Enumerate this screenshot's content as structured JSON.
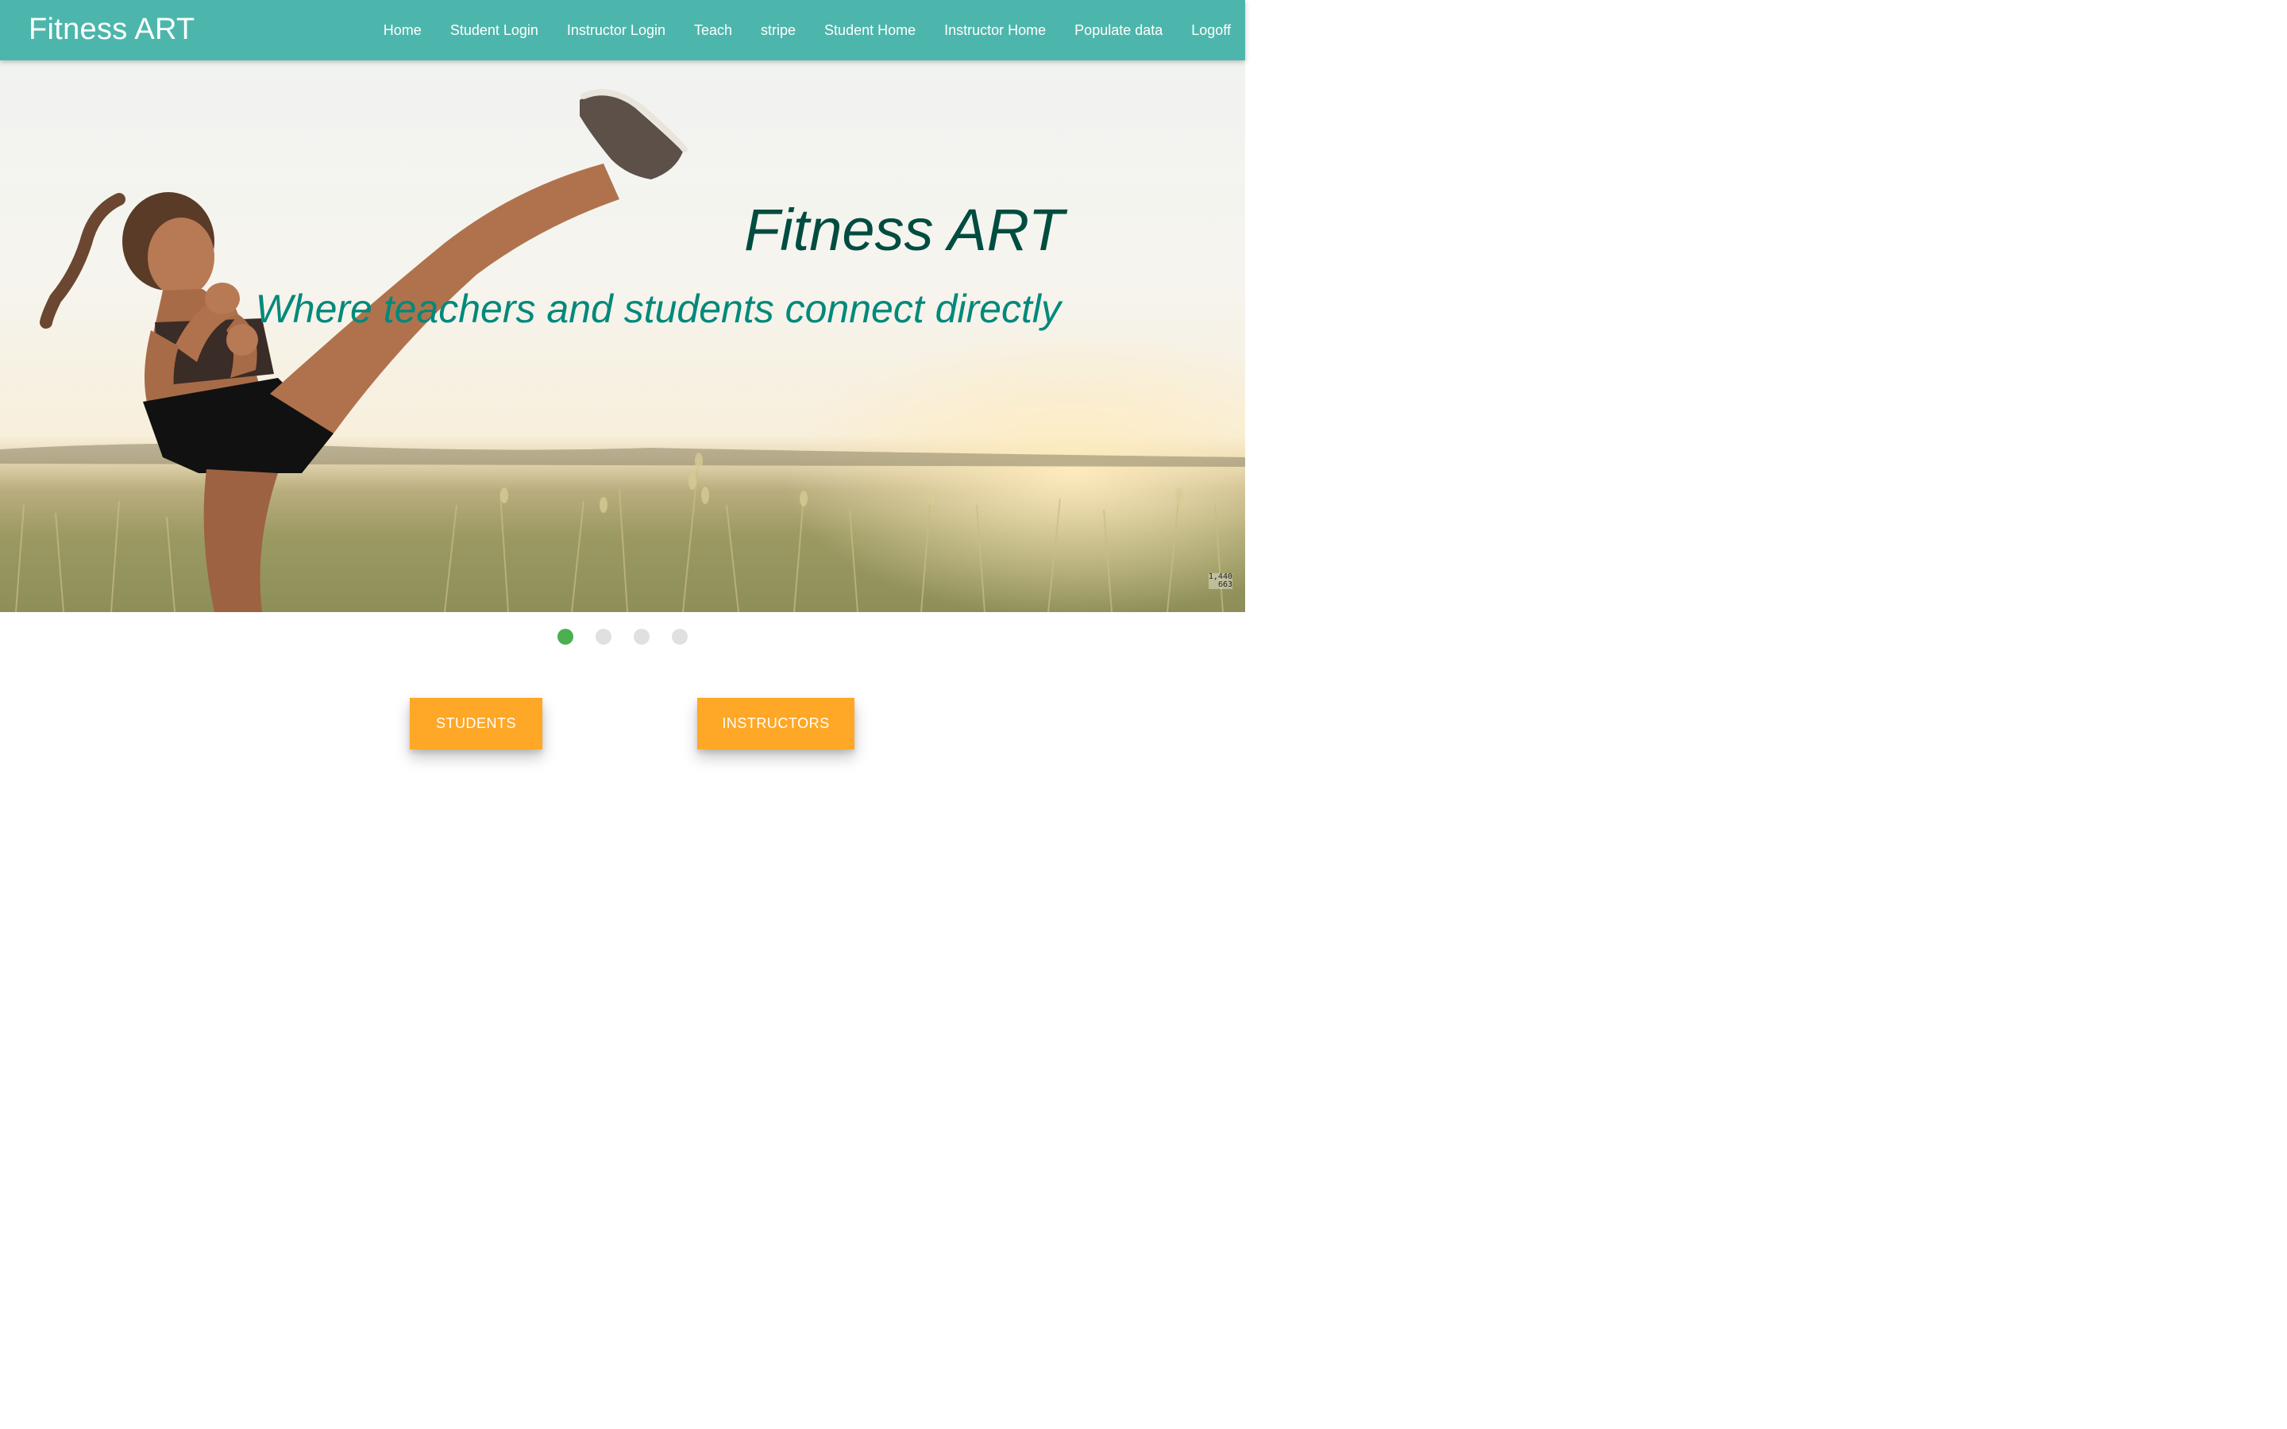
{
  "brand": "Fitness ART",
  "nav": {
    "items": [
      {
        "label": "Home"
      },
      {
        "label": "Student Login"
      },
      {
        "label": "Instructor Login"
      },
      {
        "label": "Teach"
      },
      {
        "label": "stripe"
      },
      {
        "label": "Student Home"
      },
      {
        "label": "Instructor Home"
      },
      {
        "label": "Populate data"
      },
      {
        "label": "Logoff"
      }
    ]
  },
  "hero": {
    "title": "Fitness ART",
    "subtitle": "Where teachers and students connect directly",
    "size_readout": {
      "line1": "1,440",
      "line2": "663"
    }
  },
  "slider": {
    "slide_count": 4,
    "active_index": 0
  },
  "cta": {
    "students_label": "STUDENTS",
    "instructors_label": "INSTRUCTORS"
  },
  "colors": {
    "navbar": "#4db6ac",
    "hero_title": "#004d40",
    "hero_subtitle": "#00897b",
    "indicator_active": "#4caf50",
    "indicator_inactive": "#e0e0e0",
    "button": "#ffa726"
  }
}
